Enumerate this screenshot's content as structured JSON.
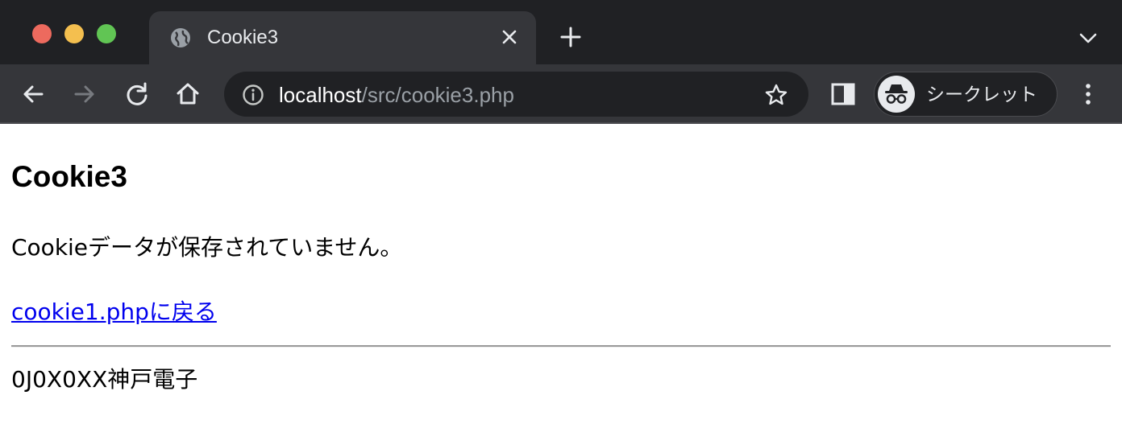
{
  "browser": {
    "tab": {
      "title": "Cookie3",
      "favicon": "globe-icon"
    },
    "address_bar": {
      "host": "localhost",
      "path": "/src/cookie3.php",
      "security_icon": "info-icon",
      "bookmark_icon": "star-icon"
    },
    "profile": {
      "label": "シークレット",
      "icon": "incognito-icon"
    },
    "icons": {
      "back": "arrow-left-icon",
      "forward": "arrow-right-icon",
      "reload": "reload-icon",
      "home": "home-icon",
      "new_tab": "plus-icon",
      "tab_close": "close-icon",
      "tab_search": "chevron-down-icon",
      "side_panel": "side-panel-icon",
      "menu": "kebab-menu-icon"
    },
    "colors": {
      "frame": "#202124",
      "toolbar": "#35363a",
      "traffic_close": "#ed6a5e",
      "traffic_minimize": "#f4bf4f",
      "traffic_maximize": "#61c554"
    }
  },
  "page": {
    "heading": "Cookie3",
    "message": "Cookieデータが保存されていません。",
    "link_text": "cookie1.phpに戻る",
    "footer": "0J0X0XX神戸電子",
    "colors": {
      "link": "#0000ee",
      "text": "#000000"
    }
  }
}
